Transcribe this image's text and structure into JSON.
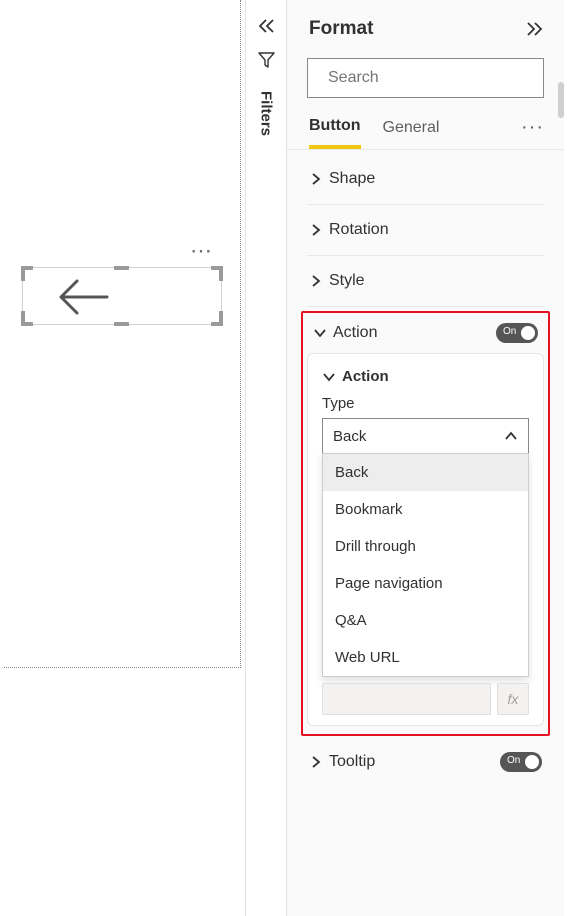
{
  "filters_strip": {
    "label": "Filters"
  },
  "format": {
    "title": "Format",
    "search_placeholder": "Search",
    "tabs": {
      "button": "Button",
      "general": "General"
    },
    "sections": {
      "shape": "Shape",
      "rotation": "Rotation",
      "style": "Style",
      "action": "Action",
      "tooltip": "Tooltip"
    },
    "toggles": {
      "on": "On"
    }
  },
  "action_card": {
    "header": "Action",
    "type_label": "Type",
    "selected": "Back",
    "options": [
      "Back",
      "Bookmark",
      "Drill through",
      "Page navigation",
      "Q&A",
      "Web URL"
    ],
    "fx": "fx"
  },
  "canvas": {
    "more": "⋯"
  }
}
